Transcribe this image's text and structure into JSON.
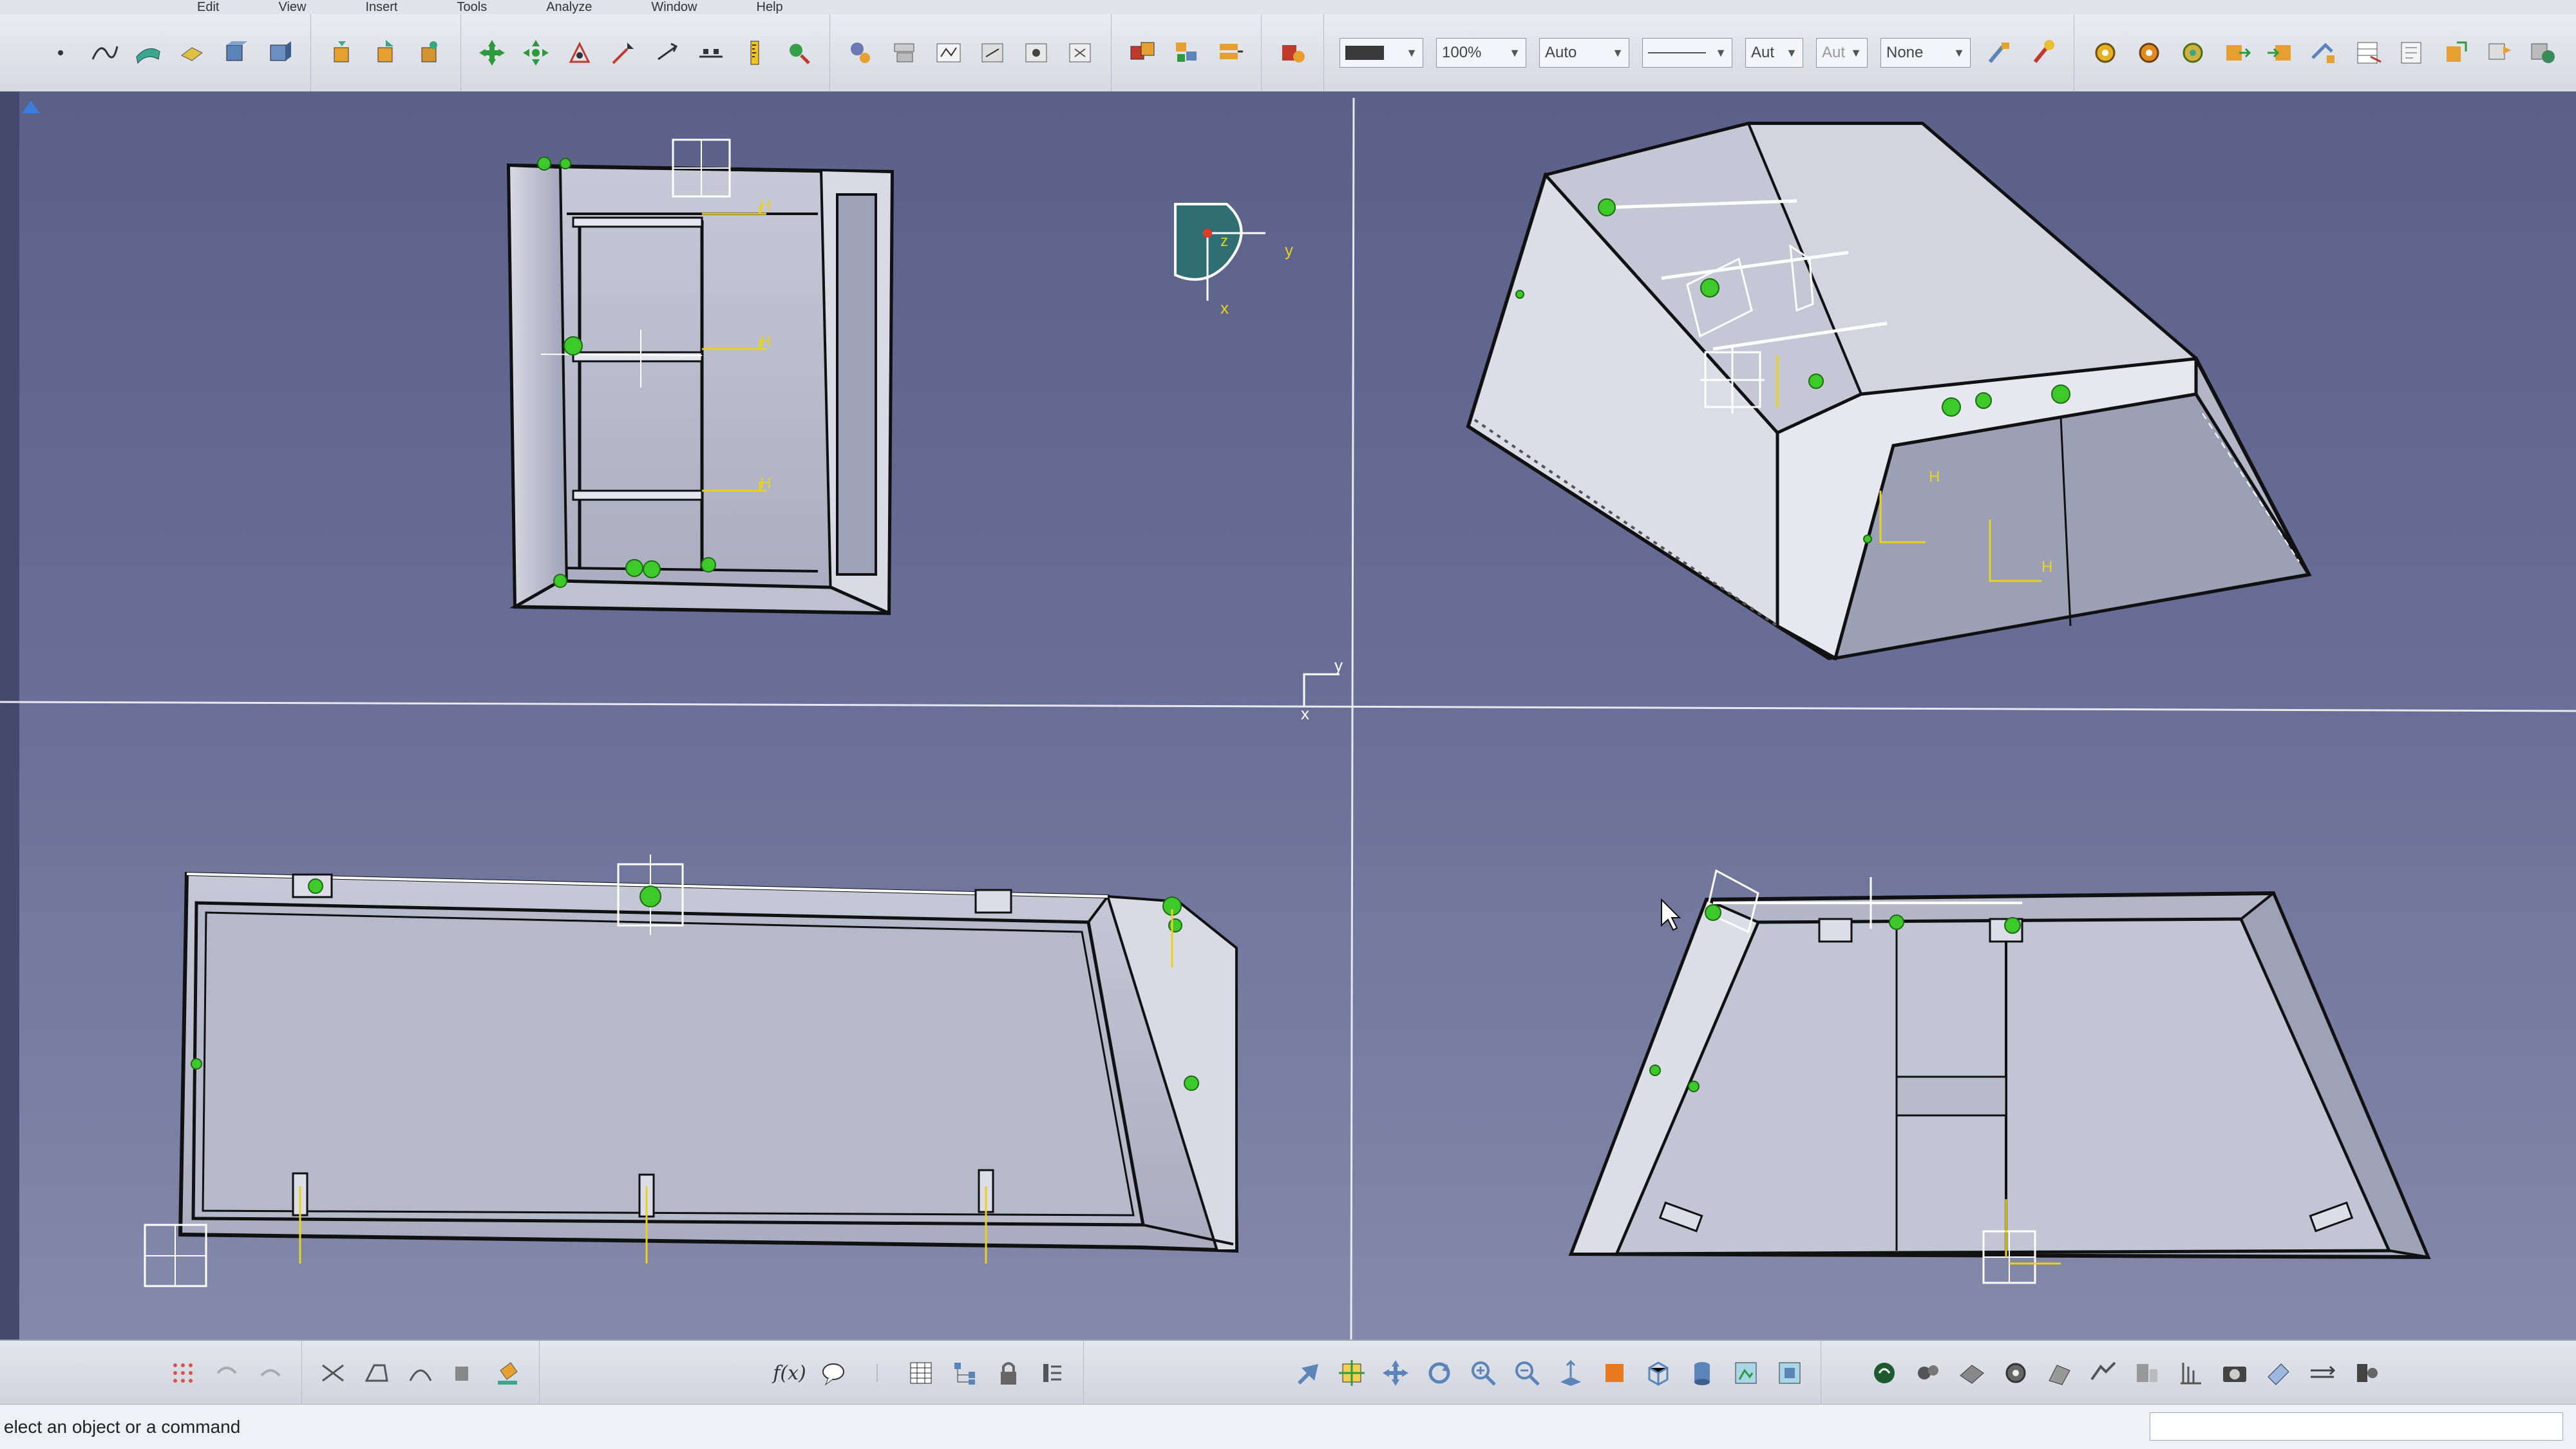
{
  "menu": {
    "items": [
      "Edit",
      "View",
      "Insert",
      "Tools",
      "Analyze",
      "Window",
      "Help"
    ]
  },
  "toolbar_top": {
    "line_weight_value": "",
    "zoom_percent": "100%",
    "auto_value": "Auto",
    "aut_value": "Aut",
    "aut_value_2": "Aut",
    "layer_value": "None"
  },
  "toolbar_bottom": {
    "formula_label": "f(x)"
  },
  "compass": {
    "label_x": "x",
    "label_y": "y",
    "label_z": "z"
  },
  "axis_marker": {
    "label_x": "x",
    "label_y": "y"
  },
  "constraint_labels": {
    "h": "H",
    "v": "V"
  },
  "status": {
    "text": "elect an object or a command"
  },
  "colors": {
    "viewport_top": "#5a6088",
    "viewport_bottom": "#858aaa",
    "constraint_yellow": "#e8d21e",
    "constraint_green": "#3ec92a",
    "model_fill": "#b8bccb",
    "model_edge": "#1a1a1a",
    "compass_fill": "#2f6e72"
  }
}
